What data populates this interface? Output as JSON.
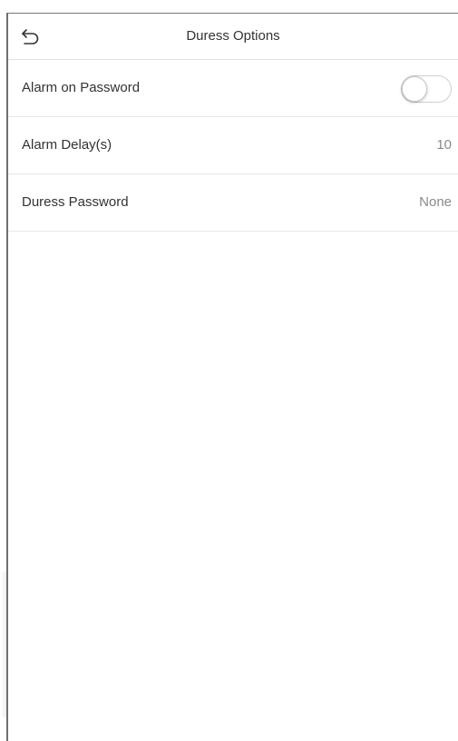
{
  "header": {
    "title": "Duress Options",
    "back_icon": "back-arrow-icon"
  },
  "settings": {
    "items": [
      {
        "label": "Alarm on Password",
        "type": "toggle",
        "enabled": false
      },
      {
        "label": "Alarm Delay(s)",
        "type": "value",
        "value": "10"
      },
      {
        "label": "Duress Password",
        "type": "value",
        "value": "None"
      }
    ]
  },
  "colors": {
    "text": "#333333",
    "value_text": "#8a8a8a",
    "divider": "#e6e6e6",
    "toggle_border": "#cfcfcf"
  }
}
